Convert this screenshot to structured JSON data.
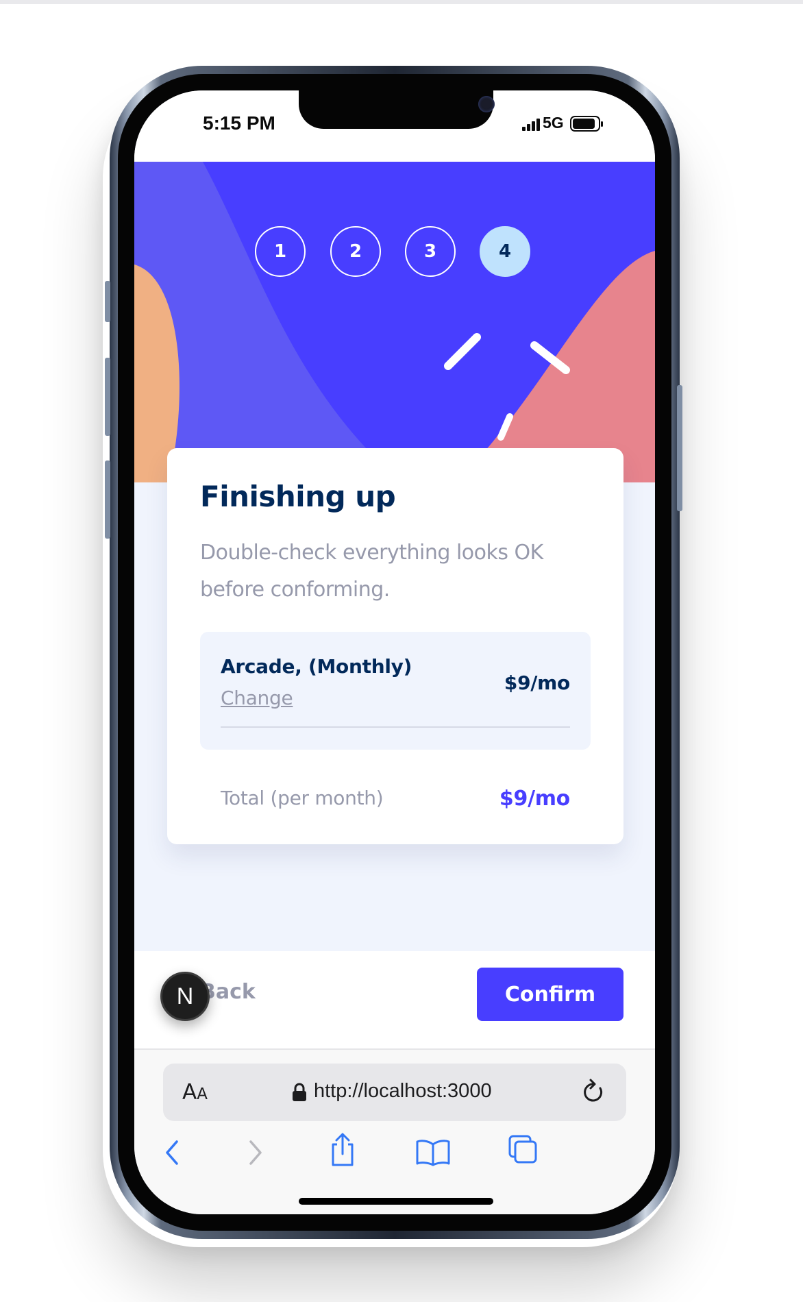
{
  "status_bar": {
    "time": "5:15 PM",
    "network": "5G",
    "battery_level": 0.9
  },
  "steps": [
    {
      "number": "1",
      "active": false
    },
    {
      "number": "2",
      "active": false
    },
    {
      "number": "3",
      "active": false
    },
    {
      "number": "4",
      "active": true
    }
  ],
  "summary": {
    "title": "Finishing up",
    "subtitle": "Double-check everything looks OK before conforming.",
    "plan_name": "Arcade, (Monthly)",
    "change_label": "Change",
    "plan_price": "$9/mo",
    "total_label": "Total (per month)",
    "total_price": "$9/mo"
  },
  "footer": {
    "back_label": "Back",
    "confirm_label": "Confirm",
    "badge_letter": "N"
  },
  "browser": {
    "aa_big": "A",
    "aa_small": "A",
    "url": "http://localhost:3000",
    "toolbar_icons": [
      "back-chevron-icon",
      "forward-chevron-icon",
      "share-icon",
      "bookmarks-icon",
      "tabs-icon"
    ]
  },
  "colors": {
    "hero_blue": "#483eff",
    "marine_blue": "#02295a",
    "cool_gray": "#9699ab",
    "light_bg": "#f0f4fd",
    "active_step": "#bfe2fd",
    "orange": "#f0b083",
    "salmon": "#e7848d",
    "ios_blue": "#3478f6"
  }
}
